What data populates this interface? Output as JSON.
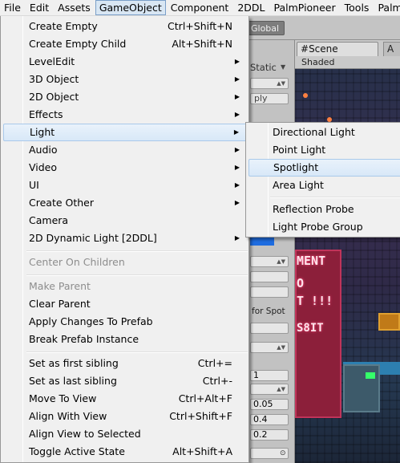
{
  "menubar": {
    "items": [
      "File",
      "Edit",
      "Assets",
      "GameObject",
      "Component",
      "2DDL",
      "PalmPioneer",
      "Tools",
      "Palm"
    ]
  },
  "background": {
    "global_label": "Global",
    "static_label": "Static",
    "apply_partial": "ply",
    "for_spot_partial": "for Spot",
    "values": [
      "1",
      "0.05",
      "0.4",
      "0.2"
    ],
    "scene_tab": "Scene",
    "scene_tab2": "A",
    "shaded_label": "Shaded",
    "game_text": [
      "MENT",
      "O",
      "T !!!",
      "S8IT"
    ]
  },
  "gameobject_menu": {
    "items": [
      {
        "label": "Create Empty",
        "shortcut": "Ctrl+Shift+N"
      },
      {
        "label": "Create Empty Child",
        "shortcut": "Alt+Shift+N"
      },
      {
        "label": "LevelEdit"
      },
      {
        "label": "3D Object"
      },
      {
        "label": "2D Object"
      },
      {
        "label": "Effects"
      },
      {
        "label": "Light"
      },
      {
        "label": "Audio"
      },
      {
        "label": "Video"
      },
      {
        "label": "UI"
      },
      {
        "label": "Create Other"
      },
      {
        "label": "Camera"
      },
      {
        "label": "2D Dynamic Light [2DDL]"
      },
      {
        "label": "Center On Children"
      },
      {
        "label": "Make Parent"
      },
      {
        "label": "Clear Parent"
      },
      {
        "label": "Apply Changes To Prefab"
      },
      {
        "label": "Break Prefab Instance"
      },
      {
        "label": "Set as first sibling",
        "shortcut": "Ctrl+="
      },
      {
        "label": "Set as last sibling",
        "shortcut": "Ctrl+-"
      },
      {
        "label": "Move To View",
        "shortcut": "Ctrl+Alt+F"
      },
      {
        "label": "Align With View",
        "shortcut": "Ctrl+Shift+F"
      },
      {
        "label": "Align View to Selected"
      },
      {
        "label": "Toggle Active State",
        "shortcut": "Alt+Shift+A"
      }
    ]
  },
  "light_submenu": {
    "items": [
      "Directional Light",
      "Point Light",
      "Spotlight",
      "Area Light",
      "Reflection Probe",
      "Light Probe Group"
    ]
  },
  "icons": {
    "submenu_arrow": "triangle-right-icon",
    "dropdown_arrow": "chevron-down-icon",
    "scene_icon": "hash-icon"
  }
}
